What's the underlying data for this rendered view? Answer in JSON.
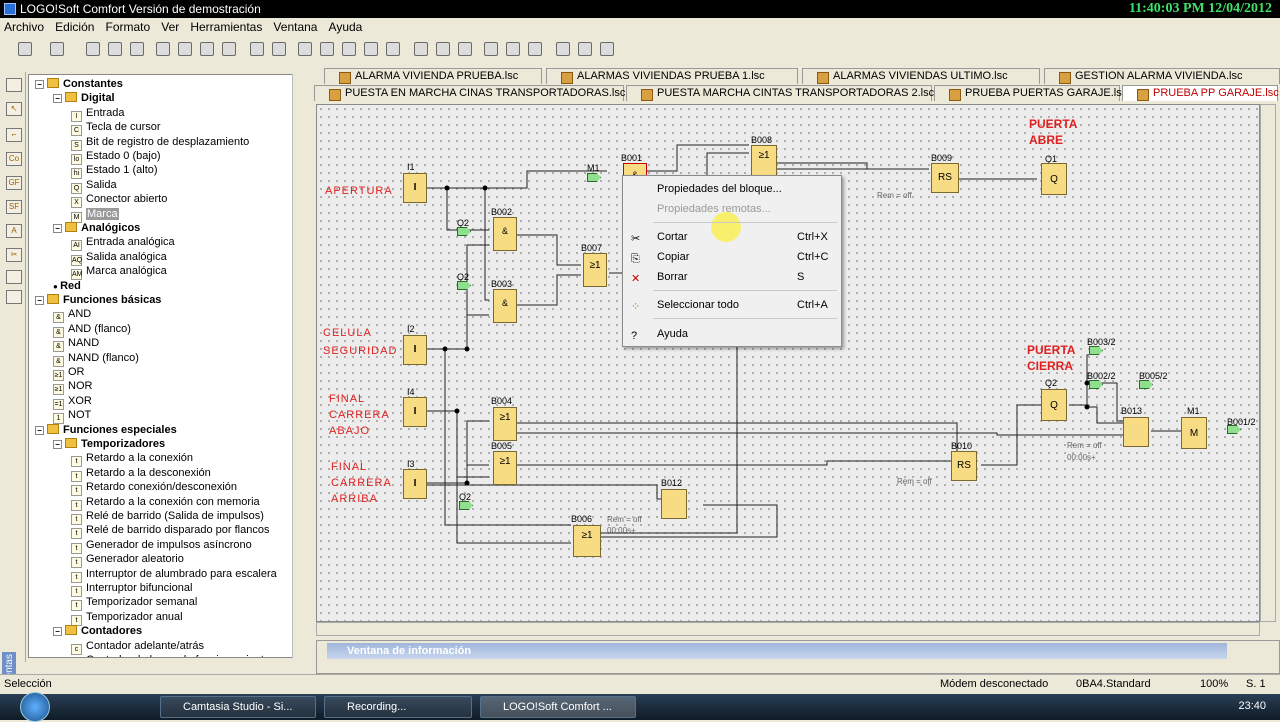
{
  "window": {
    "title": "LOGO!Soft Comfort Versión de demostración",
    "clock": "11:40:03 PM 12/04/2012"
  },
  "menu": [
    "Archivo",
    "Edición",
    "Formato",
    "Ver",
    "Herramientas",
    "Ventana",
    "Ayuda"
  ],
  "sidebar_label": "Herramientas",
  "tree": [
    {
      "label": "Constantes",
      "level": 0,
      "bold": true,
      "type": "folder"
    },
    {
      "label": "Digital",
      "level": 1,
      "bold": true,
      "type": "folder"
    },
    {
      "label": "Entrada",
      "level": 2,
      "icon": "I"
    },
    {
      "label": "Tecla de cursor",
      "level": 2,
      "icon": "C"
    },
    {
      "label": "Bit de registro de desplazamiento",
      "level": 2,
      "icon": "S"
    },
    {
      "label": "Estado 0 (bajo)",
      "level": 2,
      "icon": "lo"
    },
    {
      "label": "Estado 1 (alto)",
      "level": 2,
      "icon": "hi"
    },
    {
      "label": "Salida",
      "level": 2,
      "icon": "Q"
    },
    {
      "label": "Conector abierto",
      "level": 2,
      "icon": "X"
    },
    {
      "label": "Marca",
      "level": 2,
      "icon": "M",
      "selected": true
    },
    {
      "label": "Analógicos",
      "level": 1,
      "bold": true,
      "type": "folder"
    },
    {
      "label": "Entrada analógica",
      "level": 2,
      "icon": "AI"
    },
    {
      "label": "Salida analógica",
      "level": 2,
      "icon": "AQ"
    },
    {
      "label": "Marca analógica",
      "level": 2,
      "icon": "AM"
    },
    {
      "label": "Red",
      "level": 1,
      "bold": true,
      "type": "dot"
    },
    {
      "label": "Funciones básicas",
      "level": 0,
      "bold": true,
      "type": "folder"
    },
    {
      "label": "AND",
      "level": 1,
      "icon": "&"
    },
    {
      "label": "AND (flanco)",
      "level": 1,
      "icon": "&"
    },
    {
      "label": "NAND",
      "level": 1,
      "icon": "&"
    },
    {
      "label": "NAND (flanco)",
      "level": 1,
      "icon": "&"
    },
    {
      "label": "OR",
      "level": 1,
      "icon": "≥1"
    },
    {
      "label": "NOR",
      "level": 1,
      "icon": "≥1"
    },
    {
      "label": "XOR",
      "level": 1,
      "icon": "=1"
    },
    {
      "label": "NOT",
      "level": 1,
      "icon": "1"
    },
    {
      "label": "Funciones especiales",
      "level": 0,
      "bold": true,
      "type": "folder"
    },
    {
      "label": "Temporizadores",
      "level": 1,
      "bold": true,
      "type": "folder"
    },
    {
      "label": "Retardo a la conexión",
      "level": 2,
      "icon": "t"
    },
    {
      "label": "Retardo a la desconexión",
      "level": 2,
      "icon": "t"
    },
    {
      "label": "Retardo conexión/desconexión",
      "level": 2,
      "icon": "t"
    },
    {
      "label": "Retardo a la conexión con memoria",
      "level": 2,
      "icon": "t"
    },
    {
      "label": "Relé de barrido (Salida de impulsos)",
      "level": 2,
      "icon": "t"
    },
    {
      "label": "Relé de barrido disparado por flancos",
      "level": 2,
      "icon": "t"
    },
    {
      "label": "Generador de impulsos asíncrono",
      "level": 2,
      "icon": "t"
    },
    {
      "label": "Generador aleatorio",
      "level": 2,
      "icon": "t"
    },
    {
      "label": "Interruptor de alumbrado para escalera",
      "level": 2,
      "icon": "t"
    },
    {
      "label": "Interruptor bifuncional",
      "level": 2,
      "icon": "t"
    },
    {
      "label": "Temporizador semanal",
      "level": 2,
      "icon": "t"
    },
    {
      "label": "Temporizador anual",
      "level": 2,
      "icon": "t"
    },
    {
      "label": "Contadores",
      "level": 1,
      "bold": true,
      "type": "folder"
    },
    {
      "label": "Contador adelante/atrás",
      "level": 2,
      "icon": "c"
    },
    {
      "label": "Contador de horas de funcionamiento",
      "level": 2,
      "icon": "c"
    }
  ],
  "tabs_row1": [
    "ALARMA VIVIENDA PRUEBA.lsc",
    "ALARMAS VIVIENDAS PRUEBA 1.lsc",
    "ALARMAS VIVIENDAS ULTIMO.lsc",
    "GESTION ALARMA VIVIENDA.lsc"
  ],
  "tabs_row2": [
    "PUESTA EN MARCHA CINAS TRANSPORTADORAS.lsc",
    "PUESTA MARCHA CINTAS TRANSPORTADORAS 2.lsc",
    "PRUEBA PUERTAS GARAJE.lsc",
    "PRUEBA PP GARAJE.lsc"
  ],
  "active_tab": "PRUEBA PP GARAJE.lsc",
  "diagram": {
    "labels": {
      "apertura": "APERTURA",
      "celula1": "CELULA",
      "celula2": "SEGURIDAD",
      "fin1a": "FINAL",
      "fin1b": "CARRERA",
      "fin1c": "ABAJO",
      "fin2a": "FINAL",
      "fin2b": "CARRERA",
      "fin2c": "ARRIBA",
      "pa1": "PUERTA",
      "pa2": "ABRE",
      "pc1": "PUERTA",
      "pc2": "CIERRA"
    },
    "blocks": {
      "I1": "I1",
      "I2": "I2",
      "I4": "I4",
      "I3": "I3",
      "B001": "B001",
      "B002": "B002",
      "B003": "B003",
      "B004": "B004",
      "B005": "B005",
      "B006": "B006",
      "B007": "B007",
      "B008": "B008",
      "B009": "B009",
      "B010": "B010",
      "B012": "B012",
      "B013": "B013",
      "Q1": "Q1",
      "Q2": "Q2",
      "M1": "M1",
      "Q2a": "Q2",
      "Q2b": "Q2",
      "Q2c": "Q2",
      "M1in": "M1"
    },
    "symbols": {
      "I": "I",
      "and": "&",
      "or": "≥1",
      "rs": "RS",
      "q": "Q",
      "m": "M"
    },
    "params": {
      "rem1": "Rem = off",
      "rem2": "Rem = off",
      "rem3": "Rem = off",
      "rem4": "Rem = off",
      "rem5": "Rem = off",
      "t1": "00:00s+",
      "t2": "00:00s+"
    },
    "connectors": {
      "b003": "B003/2",
      "b005": "B005/2",
      "b002": "B002/2",
      "b001": "B001/2"
    }
  },
  "context_menu": {
    "items": [
      {
        "label": "Propiedades del bloque...",
        "shortcut": "",
        "disabled": false,
        "icon": ""
      },
      {
        "label": "Propiedades remotas...",
        "shortcut": "",
        "disabled": true,
        "icon": ""
      },
      {
        "label": "Cortar",
        "shortcut": "Ctrl+X",
        "disabled": false,
        "icon": "✂"
      },
      {
        "label": "Copiar",
        "shortcut": "Ctrl+C",
        "disabled": false,
        "icon": "⎘"
      },
      {
        "label": "Borrar",
        "shortcut": "S",
        "disabled": false,
        "icon": "✕"
      },
      {
        "label": "Seleccionar todo",
        "shortcut": "Ctrl+A",
        "disabled": false,
        "icon": "⁘"
      },
      {
        "label": "Ayuda",
        "shortcut": "",
        "disabled": false,
        "icon": "?"
      }
    ]
  },
  "info_window": {
    "title": "Ventana de información"
  },
  "status": {
    "left": "Selección",
    "modem": "Módem desconectado",
    "device": "0BA4.Standard",
    "zoom": "100%",
    "page": "S. 1"
  },
  "taskbar": {
    "items": [
      "Camtasia Studio - Si...",
      "Recording...",
      "LOGO!Soft Comfort ..."
    ],
    "time": "23:40"
  }
}
